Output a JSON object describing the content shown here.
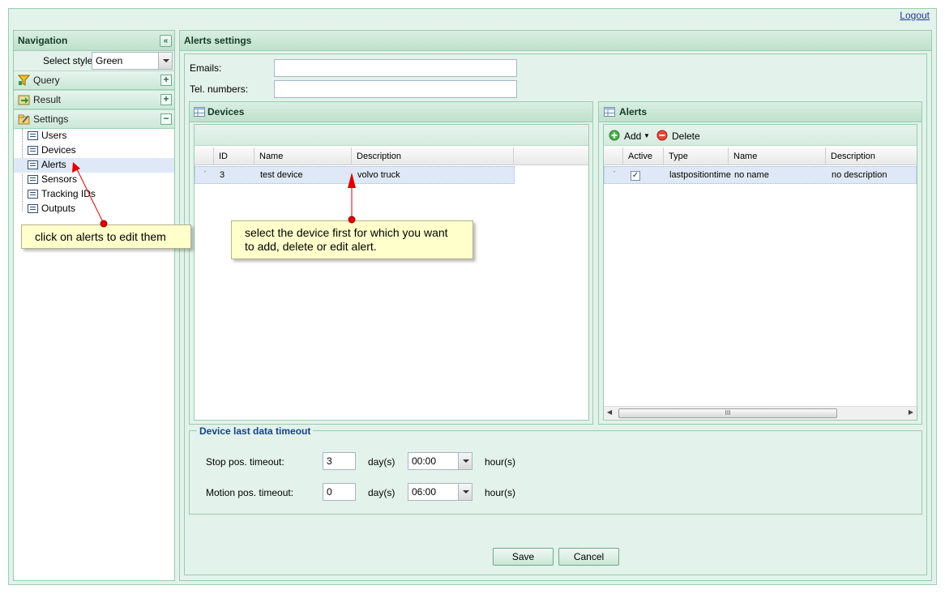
{
  "header": {
    "logout": "Logout"
  },
  "navigation": {
    "title": "Navigation",
    "select_style_label": "Select style",
    "select_style_value": "Green",
    "sections": [
      {
        "label": "Query",
        "toggle": "+"
      },
      {
        "label": "Result",
        "toggle": "+"
      },
      {
        "label": "Settings",
        "toggle": "−"
      }
    ],
    "settings_items": [
      "Users",
      "Devices",
      "Alerts",
      "Sensors",
      "Tracking IDs",
      "Outputs"
    ],
    "selected_item": "Alerts"
  },
  "alerts_settings": {
    "title": "Alerts settings",
    "emails_label": "Emails:",
    "emails_value": "",
    "tel_label": "Tel. numbers:",
    "tel_value": "",
    "devices": {
      "title": "Devices",
      "columns": [
        "ID",
        "Name",
        "Description"
      ],
      "rows": [
        {
          "id": "3",
          "name": "test device",
          "description": "volvo truck"
        }
      ]
    },
    "alerts": {
      "title": "Alerts",
      "add_label": "Add",
      "delete_label": "Delete",
      "columns": [
        "Active",
        "Type",
        "Name",
        "Description"
      ],
      "rows": [
        {
          "active": true,
          "type": "lastpositiontime",
          "name": "no name",
          "description": "no description"
        }
      ],
      "scroll_grip": "III"
    },
    "timeout": {
      "legend": "Device last data timeout",
      "stop_label": "Stop pos. timeout:",
      "stop_days": "3",
      "stop_days_unit": "day(s)",
      "stop_hours": "00:00",
      "stop_hours_unit": "hour(s)",
      "motion_label": "Motion pos. timeout:",
      "motion_days": "0",
      "motion_days_unit": "day(s)",
      "motion_hours": "06:00",
      "motion_hours_unit": "hour(s)"
    },
    "save_label": "Save",
    "cancel_label": "Cancel"
  },
  "annotations": {
    "tip_alerts": "click on alerts to edit them",
    "tip_device_line1": "select the device first for which you want",
    "tip_device_line2": "to add, delete or edit alert.",
    "arrow_color": "#e00000",
    "tip_color": "#ffffcc"
  },
  "colors": {
    "panel_bg": "#e3f2ea",
    "border": "#99ccb0",
    "header_text": "#143c28",
    "selected_row": "#dfe8f6",
    "legend_text": "#15428b"
  }
}
